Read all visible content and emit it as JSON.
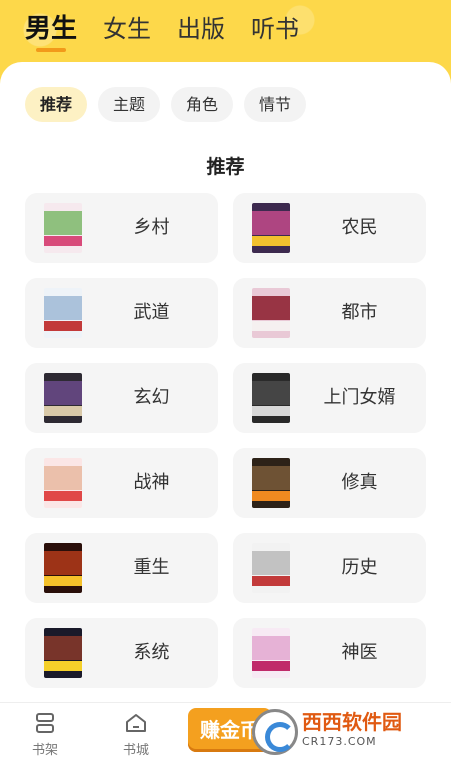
{
  "top_tabs": [
    {
      "label": "男生",
      "active": true
    },
    {
      "label": "女生",
      "active": false
    },
    {
      "label": "出版",
      "active": false
    },
    {
      "label": "听书",
      "active": false
    }
  ],
  "filters": [
    {
      "label": "推荐",
      "active": true
    },
    {
      "label": "主题",
      "active": false
    },
    {
      "label": "角色",
      "active": false
    },
    {
      "label": "情节",
      "active": false
    }
  ],
  "section_title": "推荐",
  "categories": [
    {
      "label": "乡村",
      "cover_colors": [
        "#f6e9ee",
        "#7cb96a",
        "#d84a7a"
      ]
    },
    {
      "label": "农民",
      "cover_colors": [
        "#3d2a4f",
        "#c24a8a",
        "#f2c12e"
      ]
    },
    {
      "label": "武道",
      "cover_colors": [
        "#eef3f8",
        "#9fb8d6",
        "#c23a3a"
      ]
    },
    {
      "label": "都市",
      "cover_colors": [
        "#e9c9d6",
        "#8a1a2a",
        "#f5f0f0"
      ]
    },
    {
      "label": "玄幻",
      "cover_colors": [
        "#2e2a33",
        "#6a4a8a",
        "#d9c9a8"
      ]
    },
    {
      "label": "上门女婿",
      "cover_colors": [
        "#2a2a2a",
        "#4a4a4a",
        "#d8d8d8"
      ]
    },
    {
      "label": "战神",
      "cover_colors": [
        "#fbe6e6",
        "#e8b8a0",
        "#e04848"
      ]
    },
    {
      "label": "修真",
      "cover_colors": [
        "#2d2218",
        "#7a5a3a",
        "#f08a20"
      ]
    },
    {
      "label": "重生",
      "cover_colors": [
        "#2a0f0a",
        "#b23a1a",
        "#f5c12a"
      ]
    },
    {
      "label": "历史",
      "cover_colors": [
        "#f2f2f2",
        "#bababa",
        "#c23a3a"
      ]
    },
    {
      "label": "系统",
      "cover_colors": [
        "#1a1a2a",
        "#8a3a2a",
        "#f5d02a"
      ]
    },
    {
      "label": "神医",
      "cover_colors": [
        "#f7eaf4",
        "#e3a8d0",
        "#c02a6a"
      ]
    }
  ],
  "bottom_nav": [
    {
      "label": "书架",
      "icon": "bookshelf-icon"
    },
    {
      "label": "书城",
      "icon": "home-icon"
    }
  ],
  "promo_label": "赚金币",
  "watermark": {
    "main": "西西软件园",
    "site": "CR173.COM"
  },
  "colors": {
    "brand_yellow": "#fdd84a",
    "accent_orange": "#f29a1a",
    "chip_active_bg": "#fdf1c4",
    "card_bg": "#f5f5f5"
  }
}
